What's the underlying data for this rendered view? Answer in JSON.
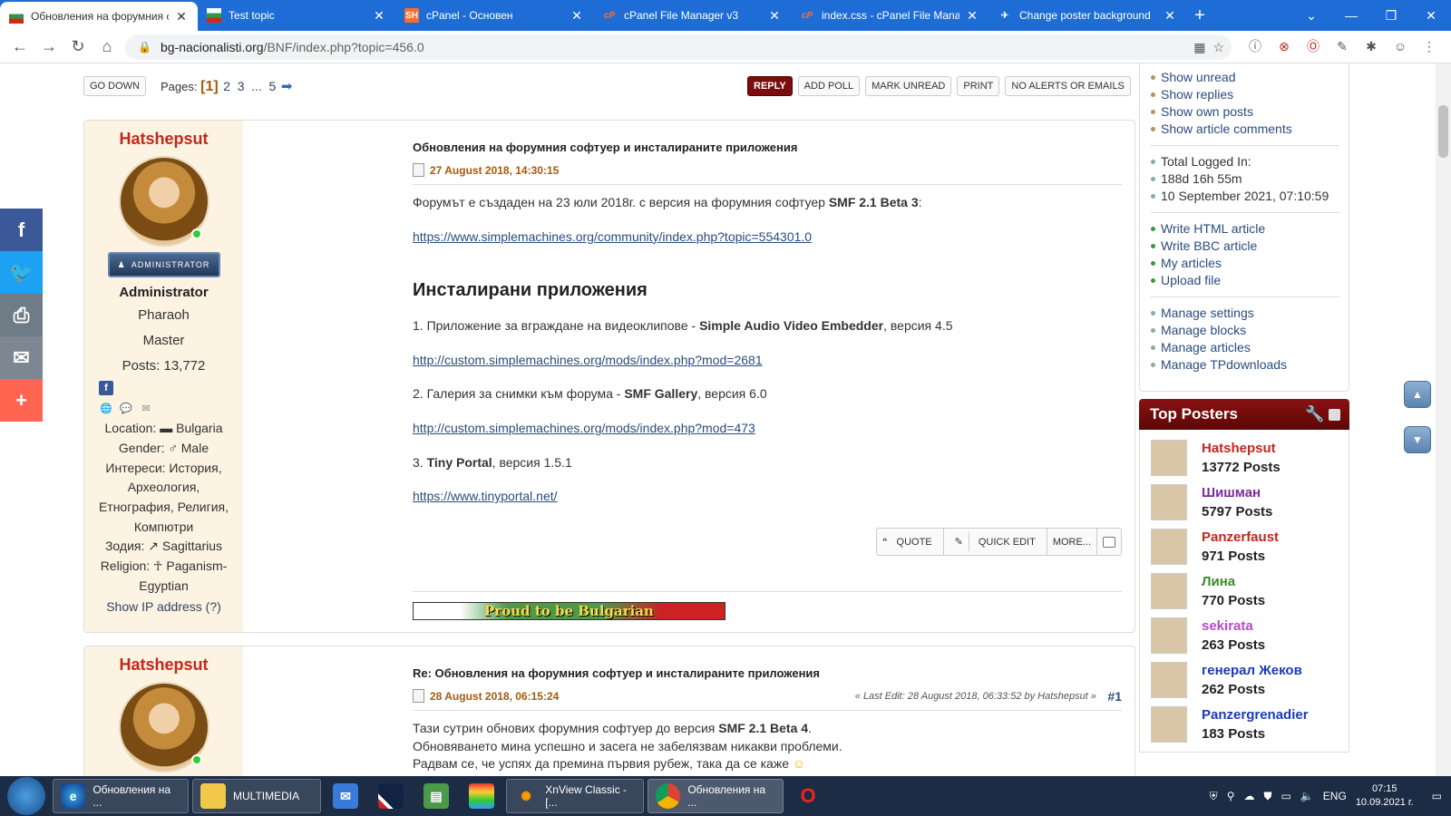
{
  "browser": {
    "tabs": [
      {
        "title": "Обновления на форумния софтуер",
        "favicon": "bulgarian-flag-icon",
        "active": true
      },
      {
        "title": "Test topic",
        "favicon": "bulgarian-flag-icon",
        "active": false
      },
      {
        "title": "cPanel - Основен",
        "favicon": "sh-icon",
        "active": false
      },
      {
        "title": "cPanel File Manager v3",
        "favicon": "cpanel-icon",
        "active": false
      },
      {
        "title": "index.css - cPanel File Manager",
        "favicon": "cpanel-icon",
        "active": false
      },
      {
        "title": "Change poster background",
        "favicon": "swallow-icon",
        "active": false
      }
    ],
    "url_host": "bg-nacionalisti.org",
    "url_path": "/BNF/index.php?topic=456.0"
  },
  "toolbar": {
    "go_down": "GO DOWN",
    "pages_label": "Pages:",
    "current_page": "[1]",
    "page_links": [
      "2",
      "3",
      "...",
      "5"
    ],
    "buttons": [
      "REPLY",
      "ADD POLL",
      "MARK UNREAD",
      "PRINT",
      "NO ALERTS OR EMAILS"
    ]
  },
  "post1": {
    "author": "Hatshepsut",
    "badge": "ADMINISTRATOR",
    "role": "Administrator",
    "title1": "Pharaoh",
    "title2": "Master",
    "posts": "Posts: 13,772",
    "location": "Location: ▬ Bulgaria",
    "gender": "Gender: ♂ Male",
    "interests": "Интереси: История, Археология, Етнография, Религия, Компютри",
    "zodiac": "Зодия: ↗ Sagittarius",
    "religion": "Religion: ☥ Paganism-Egyptian",
    "show_ip": "Show IP address (?)",
    "subject": "Обновления на форумния софтуер и инсталираните приложения",
    "date": "27 August 2018, 14:30:15",
    "p1_text": "Форумът е създаден на 23 юли 2018г. с версия на форумния софтуер ",
    "p1_bold": "SMF 2.1 Beta 3",
    "p1_end": ":",
    "link1": "https://www.simplemachines.org/community/index.php?topic=554301.0",
    "heading": "Инсталирани приложения",
    "item1_a": "1. Приложение за вграждане на видеоклипове - ",
    "item1_b": "Simple Audio Video Embedder",
    "item1_c": ", версия 4.5",
    "link2": "http://custom.simplemachines.org/mods/index.php?mod=2681",
    "item2_a": "2. Галерия за снимки към форума - ",
    "item2_b": "SMF Gallery",
    "item2_c": ", версия 6.0",
    "link3": "http://custom.simplemachines.org/mods/index.php?mod=473",
    "item3_a": "3. ",
    "item3_b": "Tiny Portal",
    "item3_c": ", версия 1.5.1",
    "link4": "https://www.tinyportal.net/",
    "quick_actions": [
      "QUOTE",
      "QUICK EDIT",
      "MORE..."
    ],
    "banner": "Proud to be Bulgarian"
  },
  "post2": {
    "author": "Hatshepsut",
    "subject": "Re: Обновления на форумния софтуер и инсталираните приложения",
    "date": "28 August 2018, 06:15:24",
    "last_edit": "« Last Edit: 28 August 2018, 06:33:52 by Hatshepsut »",
    "number": "#1",
    "line1_a": "Тази сутрин обнових форумния софтуер до версия ",
    "line1_b": "SMF 2.1 Beta 4",
    "line1_c": ".",
    "line2": "Обновяването мина успешно и засега не забелязвам никакви проблеми.",
    "line3": "Радвам се, че успях да премина първия рубеж, така да се каже"
  },
  "sidebar": {
    "group1": [
      "Show unread",
      "Show replies",
      "Show own posts",
      "Show article comments"
    ],
    "stats": [
      "Total Logged In:",
      "188d 16h 55m",
      "10 September 2021, 07:10:59"
    ],
    "group2": [
      "Write HTML article",
      "Write BBC article",
      "My articles",
      "Upload file"
    ],
    "group3": [
      "Manage settings",
      "Manage blocks",
      "Manage articles",
      "Manage TPdownloads"
    ],
    "top_posters_title": "Top Posters",
    "top_posters": [
      {
        "name": "Hatshepsut",
        "posts": "13772 Posts",
        "color": "#c0281b"
      },
      {
        "name": "Шишман",
        "posts": "5797 Posts",
        "color": "#7a2a9a"
      },
      {
        "name": "Panzerfaust",
        "posts": "971 Posts",
        "color": "#c0281b"
      },
      {
        "name": "Лина",
        "posts": "770 Posts",
        "color": "#3a8a2a"
      },
      {
        "name": "sekirata",
        "posts": "263 Posts",
        "color": "#b44ac8"
      },
      {
        "name": "генерал Жеков",
        "posts": "262 Posts",
        "color": "#1a3ab8"
      },
      {
        "name": "Panzergrenadier",
        "posts": "183 Posts",
        "color": "#1a3ab8"
      }
    ]
  },
  "taskbar": {
    "items": [
      "Обновления на ...",
      "MULTIMEDIA",
      "XnView Classic - [...",
      "Обновления на ..."
    ],
    "lang": "ENG",
    "time": "07:15",
    "date": "10.09.2021 г."
  }
}
